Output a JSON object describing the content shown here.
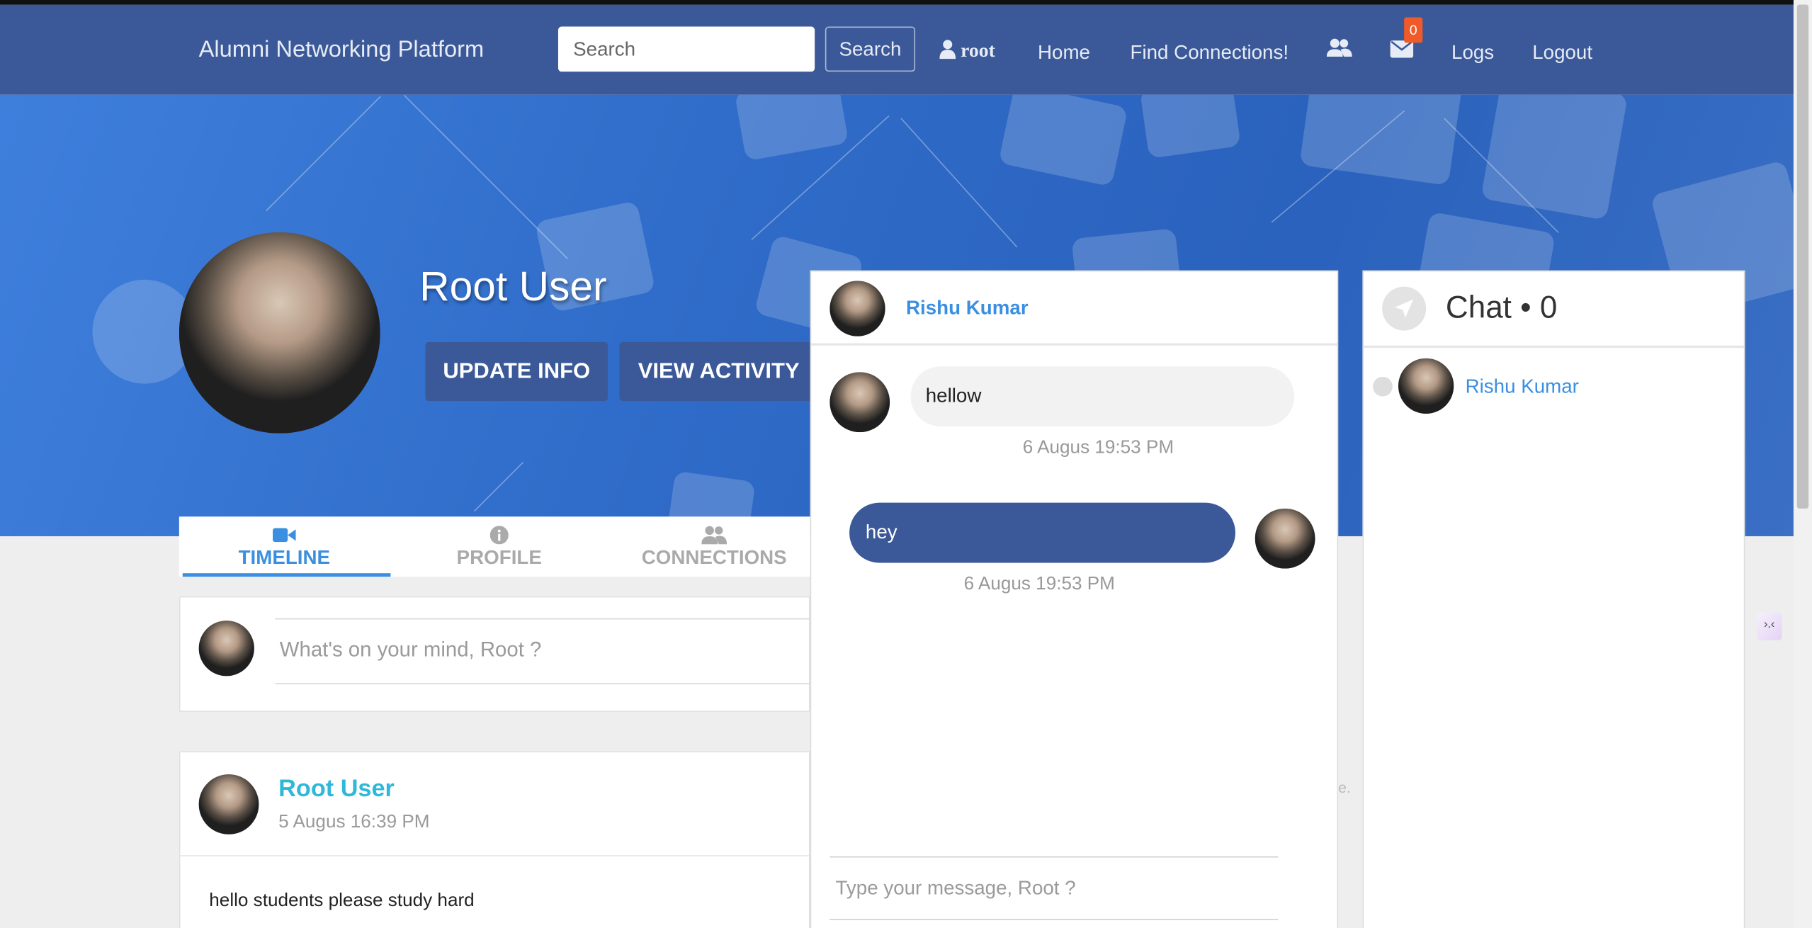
{
  "navbar": {
    "brand": "Alumni Networking Platform",
    "search_placeholder": "Search",
    "search_button": "Search",
    "user_label": "root",
    "links": {
      "home": "Home",
      "find": "Find Connections!",
      "logs": "Logs",
      "logout": "Logout"
    },
    "messages_badge": "0",
    "icons": {
      "user": "user-icon",
      "friends": "users-icon",
      "messages": "envelope-icon"
    },
    "color": "#3b5998"
  },
  "profile": {
    "name": "Root User",
    "update_button": "UPDATE INFO",
    "activity_button": "VIEW ACTIVITY"
  },
  "tabs": [
    {
      "label": "TIMELINE",
      "icon": "video-icon",
      "active": true
    },
    {
      "label": "PROFILE",
      "icon": "info-icon",
      "active": false
    },
    {
      "label": "CONNECTIONS",
      "icon": "users-icon",
      "active": false
    }
  ],
  "composer": {
    "placeholder": "What's on your mind, Root ?"
  },
  "feed": [
    {
      "author": "Root User",
      "time": "5 Augus 16:39 PM",
      "text": "hello students please study hard"
    }
  ],
  "chat_window": {
    "contact": "Rishu Kumar",
    "messages": [
      {
        "text": "hellow",
        "time": "6 Augus 19:53 PM",
        "direction": "incoming"
      },
      {
        "text": "hey",
        "time": "6 Augus 19:53 PM",
        "direction": "outgoing"
      }
    ],
    "input_placeholder": "Type your message, Root ?"
  },
  "chat_list": {
    "title": "Chat • 0",
    "contacts": [
      {
        "name": "Rishu Kumar"
      }
    ]
  },
  "misc": {
    "faint_text": "e.",
    "widget_text": "›.‹"
  }
}
